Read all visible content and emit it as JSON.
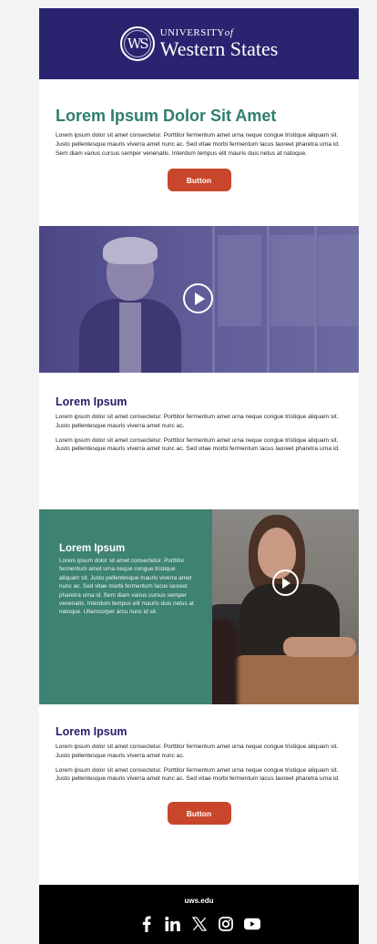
{
  "colors": {
    "page_background": "#f3f3f4",
    "brand_purple": "#2a2470",
    "heading_green": "#2e7e6e",
    "heading_purple": "#27206b",
    "button": "#c8472b",
    "split_panel": "#3e8271",
    "footer": "#000000"
  },
  "header": {
    "logo": {
      "monogram": "WS",
      "line1": "UNIVERSITY",
      "line1_suffix": "of",
      "line2": "Western States"
    }
  },
  "intro": {
    "title": "Lorem Ipsum Dolor Sit Amet",
    "body": "Lorem ipsum dolor sit amet consectetur. Porttitor fermentum amet urna neque congue tristique aliquam sit. Justo pellentesque mauris viverra amet nunc ac. Sed vitae morbi fermentum lacus laoreet pharetra urna id. Sem diam varius cursus semper venenatis. Interdum tempus elit mauris duis netus at natoque.",
    "button_label": "Button"
  },
  "video": {
    "icon": "play-icon"
  },
  "section1": {
    "title": "Lorem Ipsum",
    "paragraphs": [
      "Lorem ipsum dolor sit amet consectetur. Porttitor fermentum amet urna neque congue tristique aliquam sit. Justo pellentesque mauris viverra amet nunc ac.",
      "Lorem ipsum dolor sit amet consectetur. Porttitor fermentum amet urna neque congue tristique aliquam sit. Justo pellentesque mauris viverra amet nunc ac. Sed vitae morbi fermentum lacus laoreet pharetra urna id."
    ]
  },
  "split": {
    "title": "Lorem Ipsum",
    "body": "Lorem ipsum dolor sit amet consectetur. Porttitor fermentum amet urna neque congue tristique aliquam sit. Justo pellentesque mauris viverra amet nunc ac. Sed vitae morbi fermentum lacus laoreet pharetra urna id. Sem diam varius cursus semper venenatis. Interdum tempus elit mauris duis netus at natoque. Ullamcorper arcu nunc id sit.",
    "icon": "play-icon"
  },
  "section2": {
    "title": "Lorem Ipsum",
    "paragraphs": [
      "Lorem ipsum dolor sit amet consectetur. Porttitor fermentum amet urna neque congue tristique aliquam sit. Justo pellentesque mauris viverra amet nunc ac.",
      "Lorem ipsum dolor sit amet consectetur. Porttitor fermentum amet urna neque congue tristique aliquam sit. Justo pellentesque mauris viverra amet nunc ac. Sed vitae morbi fermentum lacus laoreet pharetra urna id."
    ],
    "button_label": "Button"
  },
  "footer": {
    "url": "uws.edu",
    "socials": [
      {
        "icon": "facebook-icon"
      },
      {
        "icon": "linkedin-icon"
      },
      {
        "icon": "x-icon"
      },
      {
        "icon": "instagram-icon"
      },
      {
        "icon": "youtube-icon"
      }
    ]
  }
}
